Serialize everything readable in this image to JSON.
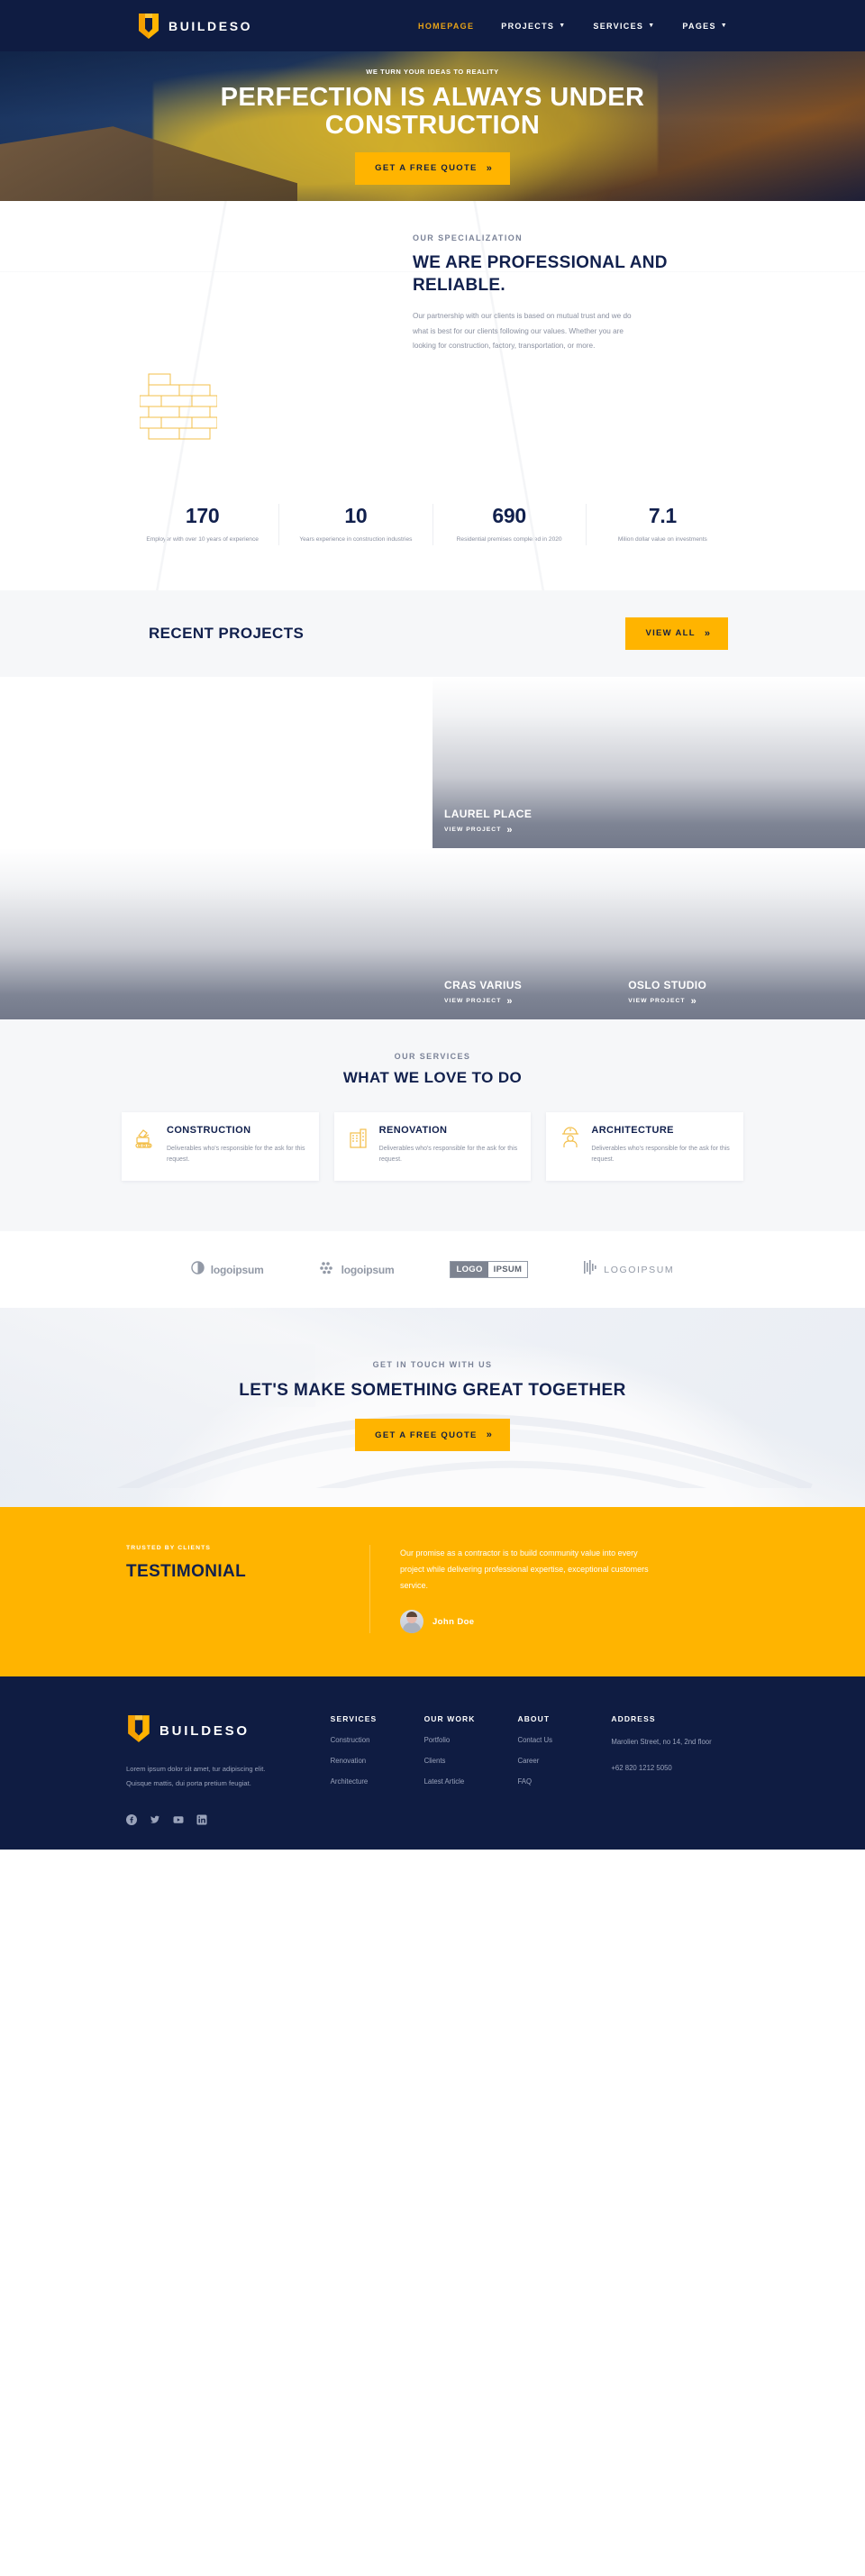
{
  "brand": {
    "name": "BUILDESO",
    "logo_icon": "buildeso-logo-mark"
  },
  "nav": {
    "items": [
      {
        "label": "HOMEPAGE",
        "has_dropdown": false,
        "active": true
      },
      {
        "label": "PROJECTS",
        "has_dropdown": true,
        "active": false
      },
      {
        "label": "SERVICES",
        "has_dropdown": true,
        "active": false
      },
      {
        "label": "PAGES",
        "has_dropdown": true,
        "active": false
      }
    ],
    "caret_icon": "chevron-down-icon"
  },
  "hero": {
    "eyebrow": "WE TURN YOUR IDEAS TO REALITY",
    "title": "PERFECTION IS ALWAYS UNDER CONSTRUCTION",
    "cta_label": "GET A FREE QUOTE",
    "cta_icon": "double-chevron-right-icon"
  },
  "about": {
    "eyebrow": "OUR SPECIALIZATION",
    "heading": "WE ARE PROFESSIONAL AND RELIABLE.",
    "paragraph": "Our partnership with our clients is based on mutual trust and we do what is best for our clients following our values. Whether you are looking for construction, factory, transportation, or more.",
    "illustration_icon": "brick-wall-illustration"
  },
  "stats": [
    {
      "value": "170",
      "label": "Employer with over 10 years of experience"
    },
    {
      "value": "10",
      "label": "Years experience in construction industries"
    },
    {
      "value": "690",
      "label": "Residential premises completed in 2020"
    },
    {
      "value": "7.1",
      "label": "Milion dollar value on investments"
    }
  ],
  "projects": {
    "title": "RECENT PROJECTS",
    "view_all_label": "VIEW ALL",
    "view_all_icon": "double-chevron-right-icon",
    "link_label": "VIEW PROJECT",
    "link_icon": "double-chevron-right-icon",
    "items": [
      {
        "name": "LAUREL PLACE"
      },
      {
        "name": "CRAS VARIUS"
      },
      {
        "name": "OSLO STUDIO"
      }
    ]
  },
  "services": {
    "eyebrow": "OUR SERVICES",
    "heading": "WHAT WE LOVE TO DO",
    "cards": [
      {
        "title": "CONSTRUCTION",
        "desc": "Deliverables who's responsible for the ask for this request.",
        "icon": "excavator-icon"
      },
      {
        "title": "RENOVATION",
        "desc": "Deliverables who's responsible for the ask for this request.",
        "icon": "building-icon"
      },
      {
        "title": "ARCHITECTURE",
        "desc": "Deliverables who's responsible for the ask for this request.",
        "icon": "worker-helmet-icon"
      }
    ]
  },
  "logos": [
    {
      "text": "logoipsum",
      "icon": "split-circle-icon"
    },
    {
      "text": "logoipsum",
      "icon": "dots-cluster-icon"
    },
    {
      "text_a": "LOGO",
      "text_b": "IPSUM",
      "icon": "boxed-logo-icon"
    },
    {
      "text": "LOGOIPSUM",
      "icon": "bars-icon"
    }
  ],
  "cta": {
    "eyebrow": "GET IN TOUCH WITH US",
    "heading": "LET'S MAKE SOMETHING GREAT TOGETHER",
    "button_label": "GET A FREE QUOTE",
    "button_icon": "double-chevron-right-icon"
  },
  "testimonial": {
    "eyebrow": "TRUSTED BY CLIENTS",
    "title": "TESTIMONIAL",
    "quote": "Our promise as a contractor is to build community value into every project while delivering professional expertise, exceptional customers service.",
    "author": "John Doe",
    "avatar_icon": "person-avatar"
  },
  "footer": {
    "brand": "BUILDESO",
    "description": "Lorem ipsum dolor sit amet, tur adipiscing elit. Quisque mattis, dui porta pretium feugiat.",
    "columns": [
      {
        "heading": "SERVICES",
        "links": [
          "Construction",
          "Renovation",
          "Architecture"
        ]
      },
      {
        "heading": "OUR WORK",
        "links": [
          "Portfolio",
          "Clients",
          "Latest Article"
        ]
      },
      {
        "heading": "ABOUT",
        "links": [
          "Contact Us",
          "Career",
          "FAQ"
        ]
      }
    ],
    "address": {
      "heading": "ADDRESS",
      "street": "Marolien Street, no 14, 2nd floor",
      "phone": "+62 820 1212 5050"
    },
    "socials": [
      {
        "name": "facebook-icon"
      },
      {
        "name": "twitter-icon"
      },
      {
        "name": "youtube-icon"
      },
      {
        "name": "linkedin-icon"
      }
    ]
  },
  "colors": {
    "navy": "#0f1c42",
    "yellow": "#FFB400",
    "gray": "#8a90a0",
    "light": "#f6f7f9"
  }
}
